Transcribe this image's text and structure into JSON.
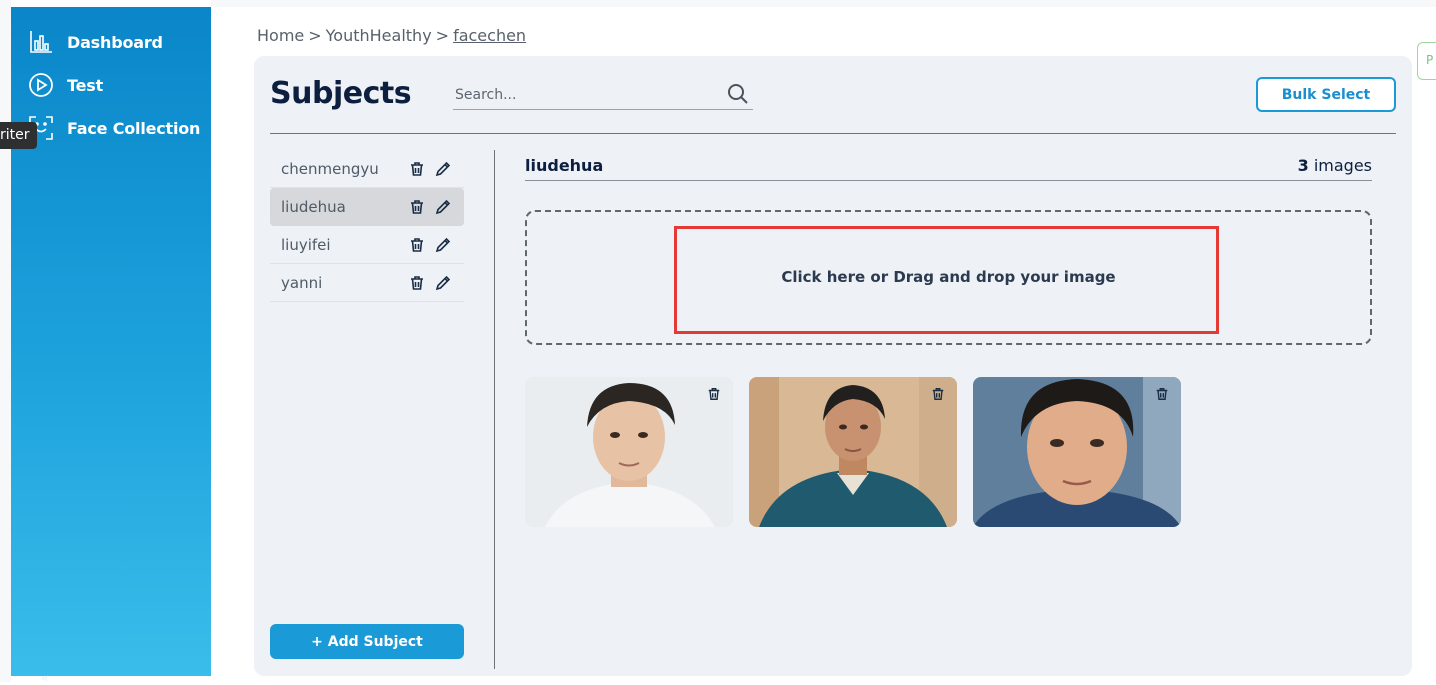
{
  "sidebar": {
    "items": [
      {
        "label": "Dashboard",
        "icon": "chart-icon"
      },
      {
        "label": "Test",
        "icon": "play-circle-icon"
      },
      {
        "label": "Face Collection",
        "icon": "face-scan-icon"
      }
    ],
    "tooltip": "riter",
    "collapse_glyph": "«"
  },
  "breadcrumb": {
    "items": [
      "Home",
      "YouthHealthy",
      "facechen"
    ],
    "separator": ">"
  },
  "page": {
    "title": "Subjects",
    "search_placeholder": "Search...",
    "bulk_select_label": "Bulk Select",
    "add_subject_label": "+ Add Subject"
  },
  "subjects": [
    {
      "name": "chenmengyu",
      "active": false
    },
    {
      "name": "liudehua",
      "active": true
    },
    {
      "name": "liuyifei",
      "active": false
    },
    {
      "name": "yanni",
      "active": false
    }
  ],
  "detail": {
    "subject_name": "liudehua",
    "image_count": "3",
    "image_count_suffix": "images",
    "dropzone_text": "Click here or Drag and drop your image"
  },
  "images": [
    {
      "alt": "liudehua photo 1",
      "background": "#e9edf0",
      "clothing": "#f4f6f7"
    },
    {
      "alt": "liudehua photo 2",
      "background": "#d9b896",
      "clothing": "#1f5a6e"
    },
    {
      "alt": "liudehua photo 3",
      "background": "#5f7f9c",
      "clothing": "#2a4a73"
    }
  ],
  "edge_button": {
    "label": "P"
  },
  "colors": {
    "accent": "#1a9ad6",
    "title": "#0c1f3f",
    "highlight_box": "#e53935",
    "panel_bg": "#eef1f6"
  }
}
